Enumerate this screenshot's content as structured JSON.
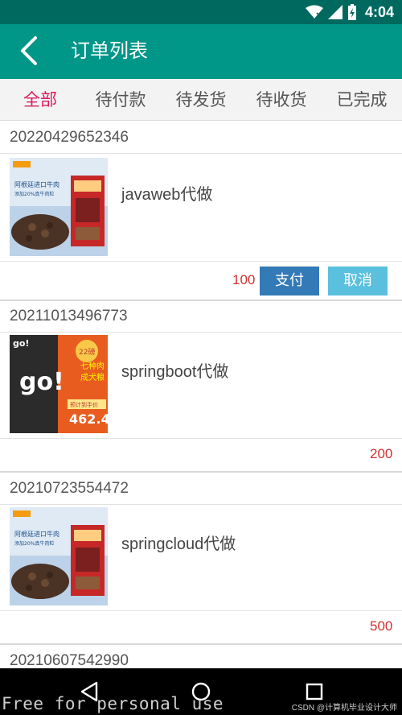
{
  "status_bar": {
    "time": "4:04"
  },
  "header": {
    "title": "订单列表"
  },
  "tabs": [
    "全部",
    "待付款",
    "待发货",
    "待收货",
    "已完成"
  ],
  "orders": [
    {
      "order_no": "20220429652346",
      "product": "javaweb代做",
      "price": "100",
      "pay_label": "支付",
      "cancel_label": "取消",
      "image": "beef-dog-food-bag"
    },
    {
      "order_no": "20211013496773",
      "product": "springboot代做",
      "price": "200",
      "image": "go-dog-food-bag"
    },
    {
      "order_no": "20210723554472",
      "product": "springcloud代做",
      "price": "500",
      "image": "beef-dog-food-bag"
    },
    {
      "order_no": "20210607542990"
    }
  ],
  "pack_a": {
    "tagline": "阿根廷进口牛肉",
    "sub": "添加20%真牛肉粒"
  },
  "pack_b": {
    "brand": "go!",
    "badge": "22磅",
    "promo1": "七种肉",
    "promo2": "成犬粮",
    "price_banner": "预计到手价",
    "price": "462.4"
  },
  "watermark": "Free for personal use",
  "credit": "CSDN @计算机毕业设计大师"
}
